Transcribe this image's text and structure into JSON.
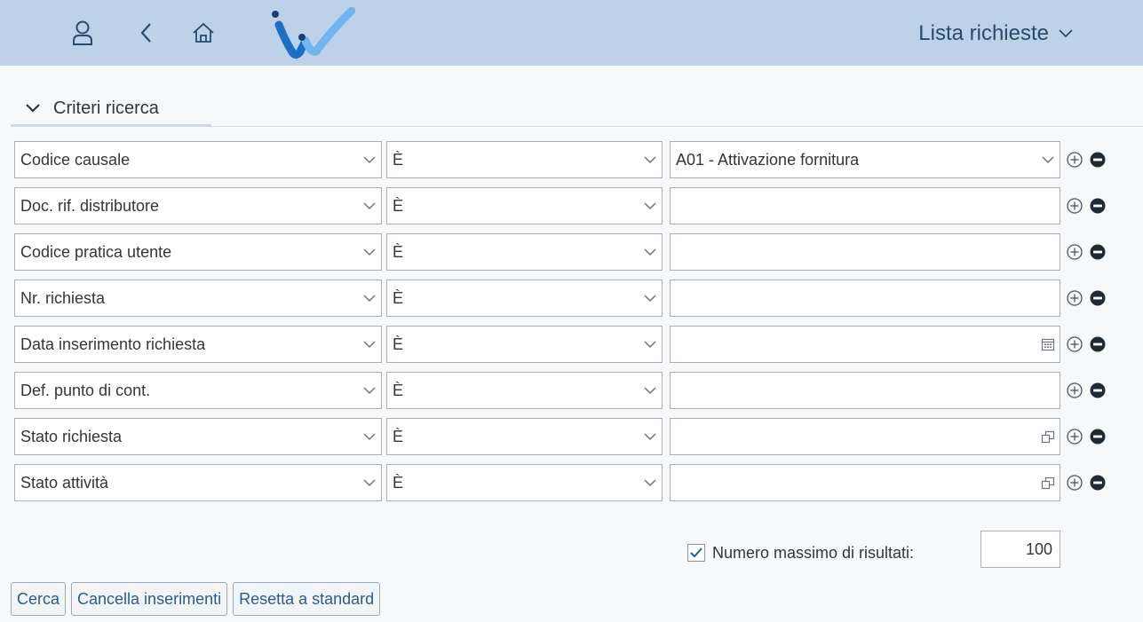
{
  "shell": {
    "icons": [
      "user-icon",
      "back-icon",
      "home-icon"
    ],
    "app_title": "Lista richieste"
  },
  "panel": {
    "title": "Criteri ricerca"
  },
  "criteria": [
    {
      "field": "Codice causale",
      "operator": "È",
      "value": "A01 - Attivazione fornitura",
      "value_type": "dropdown"
    },
    {
      "field": "Doc. rif. distributore",
      "operator": "È",
      "value": "",
      "value_type": "text"
    },
    {
      "field": "Codice pratica utente",
      "operator": "È",
      "value": "",
      "value_type": "text"
    },
    {
      "field": "Nr. richiesta",
      "operator": "È",
      "value": "",
      "value_type": "text"
    },
    {
      "field": "Data inserimento richiesta",
      "operator": "È",
      "value": "",
      "value_type": "date"
    },
    {
      "field": "Def. punto di cont.",
      "operator": "È",
      "value": "",
      "value_type": "text"
    },
    {
      "field": "Stato richiesta",
      "operator": "È",
      "value": "",
      "value_type": "valuehelp"
    },
    {
      "field": "Stato attività",
      "operator": "È",
      "value": "",
      "value_type": "valuehelp"
    }
  ],
  "max_results": {
    "checked": true,
    "label": "Numero massimo di risultati:",
    "value": "100"
  },
  "buttons": {
    "search": "Cerca",
    "clear": "Cancella inserimenti",
    "reset": "Resetta a standard"
  },
  "colors": {
    "shellbar": "#bdd1e8",
    "logo_blue": "#1b6fc4",
    "logo_light": "#6fb6f0",
    "logo_dark": "#1a3e73"
  }
}
